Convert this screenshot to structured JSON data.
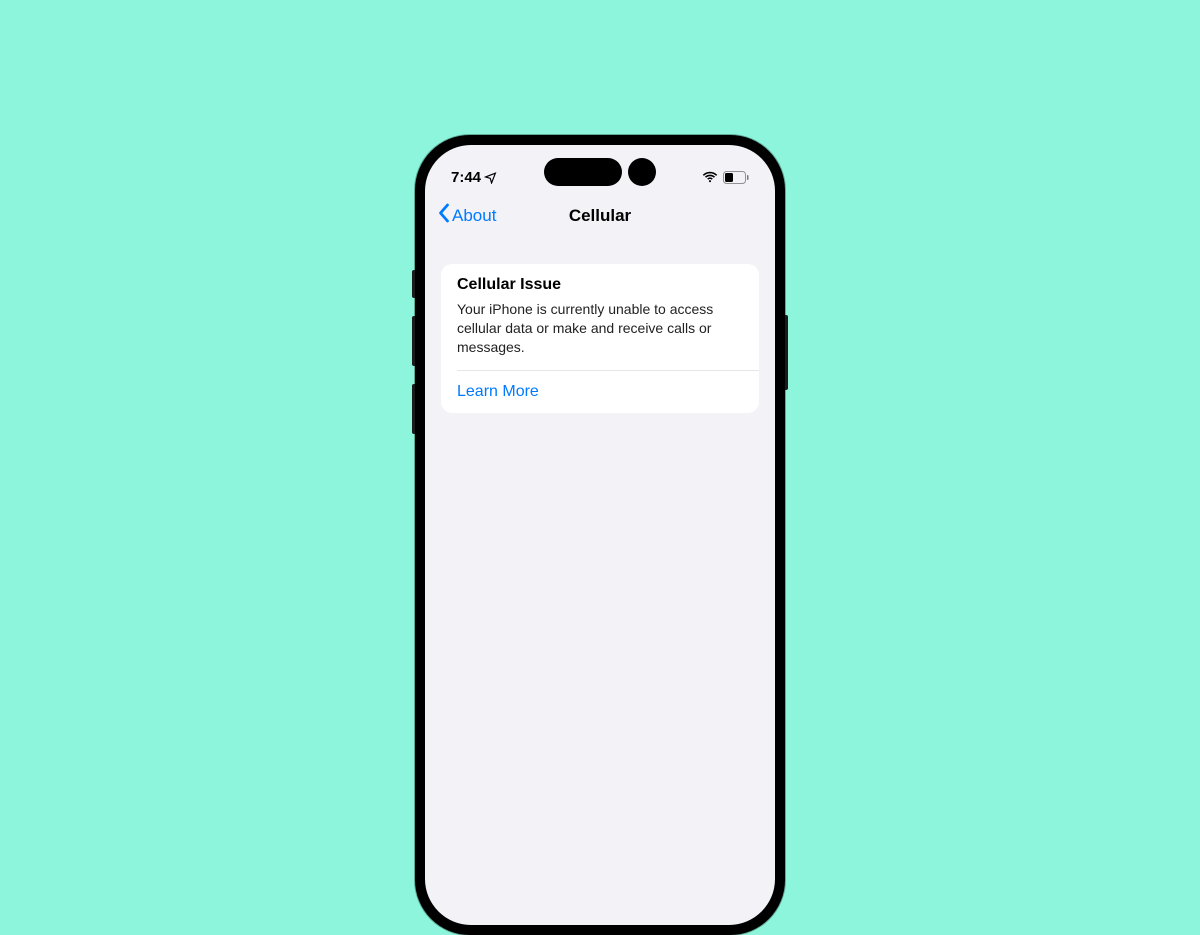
{
  "status_bar": {
    "time": "7:44"
  },
  "nav": {
    "back_label": "About",
    "title": "Cellular"
  },
  "card": {
    "title": "Cellular Issue",
    "body": "Your iPhone is currently unable to access cellular data or make and receive calls or messages.",
    "action": "Learn More"
  }
}
